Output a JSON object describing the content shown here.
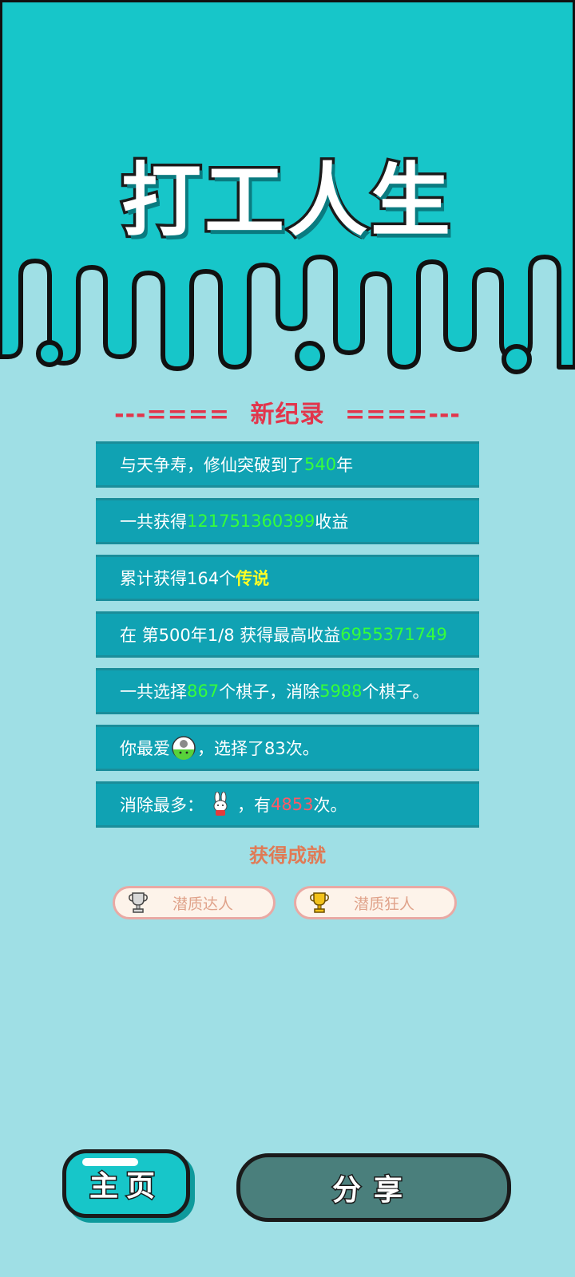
{
  "app": {
    "title": "打工人生"
  },
  "records": {
    "heading_left": "---====",
    "heading": "新纪录",
    "heading_right": "====---",
    "row1": {
      "pre": "与天争寿，修仙突破到了",
      "value": "540",
      "post": "年"
    },
    "row2": {
      "pre": "一共获得",
      "value": "121751360399",
      "post": "收益"
    },
    "row3": {
      "pre": "累计获得164个",
      "value": "传说"
    },
    "row4": {
      "pre": "在 第500年1/8 获得最高收益",
      "value": "6955371749"
    },
    "row5": {
      "pre": "一共选择",
      "v1": "867",
      "mid": "个棋子，消除",
      "v2": "5988",
      "post": "个棋子。"
    },
    "row6": {
      "pre": "你最爱",
      "post": "，选择了83次。",
      "icon": "green-slime-icon"
    },
    "row7": {
      "pre": "消除最多：",
      "mid": "，有",
      "value": "4853",
      "post": "次。",
      "icon": "rabbit-icon"
    }
  },
  "achievements": {
    "title": "获得成就",
    "items": [
      {
        "label": "潜质达人",
        "icon": "silver-trophy-icon"
      },
      {
        "label": "潜质狂人",
        "icon": "gold-trophy-icon"
      }
    ]
  },
  "footer": {
    "home_label": "主页",
    "share_label": "分享"
  },
  "colors": {
    "header": "#17c6c9",
    "background": "#9fdfe5",
    "row": "#10a2b3",
    "highlight_green": "#35ff3a",
    "highlight_yellow": "#fffd24",
    "highlight_red": "#ff5a66",
    "heading_red": "#e2354b",
    "share_button": "#4a7f7c"
  }
}
